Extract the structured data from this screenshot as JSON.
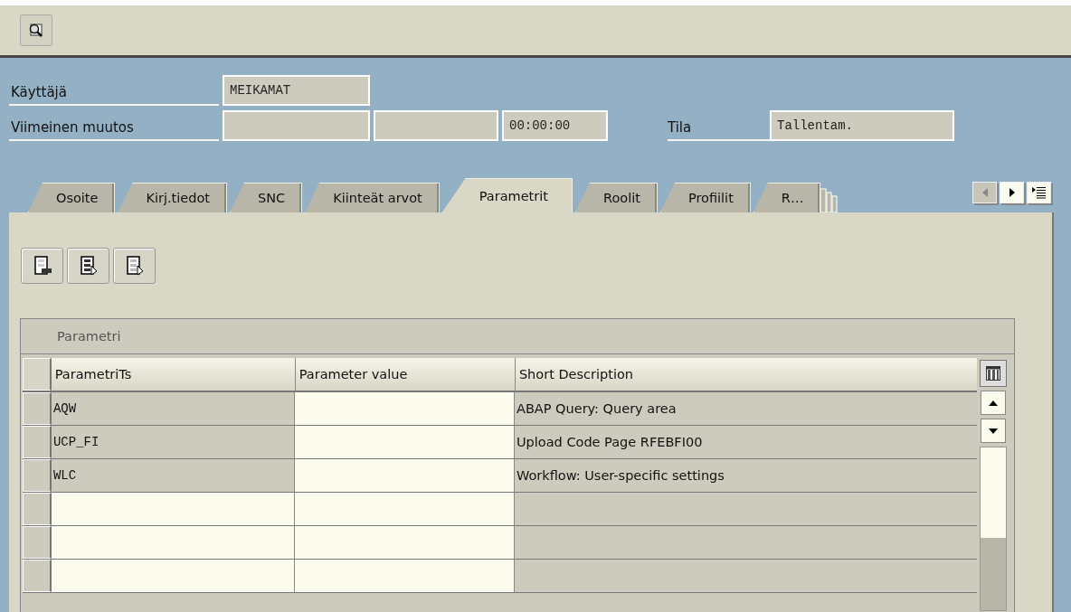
{
  "header_fields": [
    {
      "label": "Käyttäjä",
      "values": [
        {
          "kind": "text",
          "value": "MEIKAMAT"
        }
      ]
    },
    {
      "label": "Viimeinen muutos",
      "values": [
        {
          "kind": "empty"
        },
        {
          "kind": "empty"
        },
        {
          "kind": "text",
          "value": "00:00:00"
        }
      ],
      "extra_label": "Tila",
      "extra_value": "Tallentam."
    }
  ],
  "tabs": [
    {
      "label": "Osoite",
      "selected": false
    },
    {
      "label": "Kirj.tiedot",
      "selected": false
    },
    {
      "label": "SNC",
      "selected": false
    },
    {
      "label": "Kiinteät arvot",
      "selected": false
    },
    {
      "label": "Parametrit",
      "selected": true
    },
    {
      "label": "Roolit",
      "selected": false
    },
    {
      "label": "Profiilit",
      "selected": false
    },
    {
      "label": "R…",
      "selected": false
    }
  ],
  "table": {
    "title": "Parametri",
    "columns": [
      "ParametriTs",
      "Parameter value",
      "Short Description"
    ],
    "rows": [
      {
        "kind": "data",
        "id": "AQW",
        "description": "ABAP Query: Query area"
      },
      {
        "kind": "data",
        "id": "UCP_FI",
        "description": "Upload Code Page RFEBFI00"
      },
      {
        "kind": "data",
        "id": "WLC",
        "description": "Workflow: User-specific settings"
      },
      {
        "kind": "blank"
      },
      {
        "kind": "blank"
      },
      {
        "kind": "blank"
      }
    ]
  }
}
